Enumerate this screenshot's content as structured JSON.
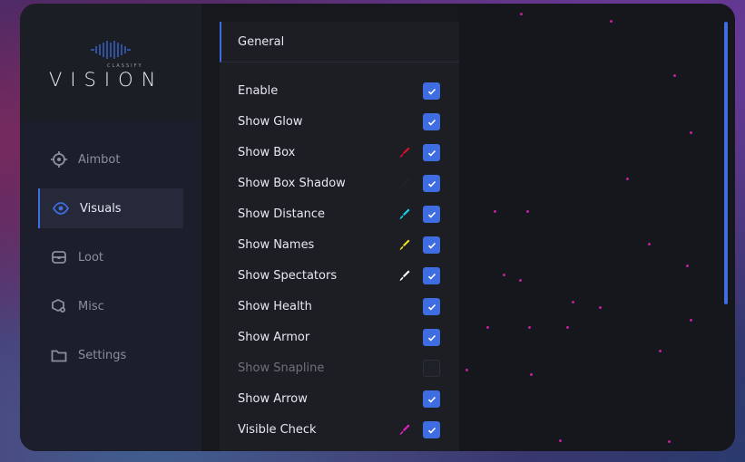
{
  "logo": {
    "tagline": "CLASSIFY",
    "title": "VISION"
  },
  "sidebar": {
    "items": [
      {
        "label": "Aimbot",
        "icon": "crosshair-icon",
        "active": false
      },
      {
        "label": "Visuals",
        "icon": "eye-icon",
        "active": true
      },
      {
        "label": "Loot",
        "icon": "chest-icon",
        "active": false
      },
      {
        "label": "Misc",
        "icon": "gear-box-icon",
        "active": false
      },
      {
        "label": "Settings",
        "icon": "folder-icon",
        "active": false
      }
    ]
  },
  "panel": {
    "header": "General",
    "options": [
      {
        "label": "Enable",
        "checked": true,
        "color": null
      },
      {
        "label": "Show Glow",
        "checked": true,
        "color": null
      },
      {
        "label": "Show Box",
        "checked": true,
        "color": "#e0102a"
      },
      {
        "label": "Show Box Shadow",
        "checked": true,
        "color": "#22242a"
      },
      {
        "label": "Show Distance",
        "checked": true,
        "color": "#18d6f0"
      },
      {
        "label": "Show Names",
        "checked": true,
        "color": "#f2e21a"
      },
      {
        "label": "Show Spectators",
        "checked": true,
        "color": "#ffffff"
      },
      {
        "label": "Show Health",
        "checked": true,
        "color": null
      },
      {
        "label": "Show Armor",
        "checked": true,
        "color": null
      },
      {
        "label": "Show Snapline",
        "checked": false,
        "color": null
      },
      {
        "label": "Show Arrow",
        "checked": true,
        "color": null
      },
      {
        "label": "Visible Check",
        "checked": true,
        "color": "#e61fc8"
      }
    ]
  },
  "colors": {
    "accent": "#3d6de0",
    "background": "#17181d"
  }
}
